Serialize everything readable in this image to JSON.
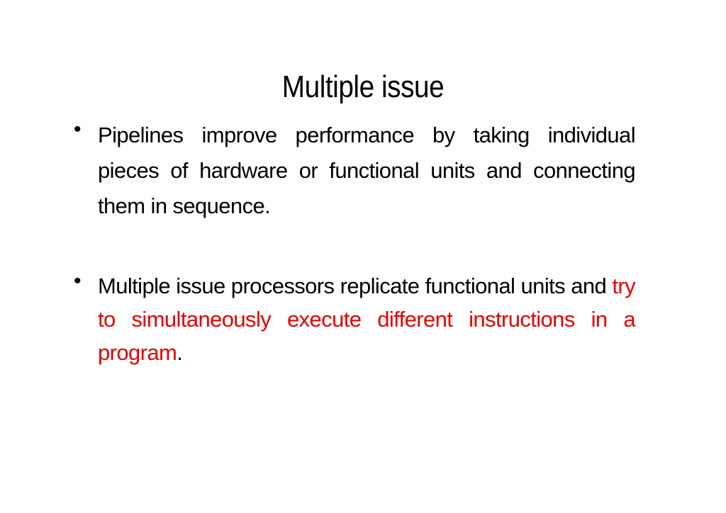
{
  "slide": {
    "title": "Multiple issue",
    "bullets": [
      {
        "marker": "•",
        "text": "Pipelines improve performance by taking individual pieces of hardware or functional units and connecting them in sequence."
      },
      {
        "marker": "•",
        "text_before": "Multiple issue processors replicate functional units and ",
        "text_highlight": "try to simultaneously execute different instructions in a program",
        "text_after": ".",
        "highlight_color": "#e60000"
      }
    ]
  }
}
